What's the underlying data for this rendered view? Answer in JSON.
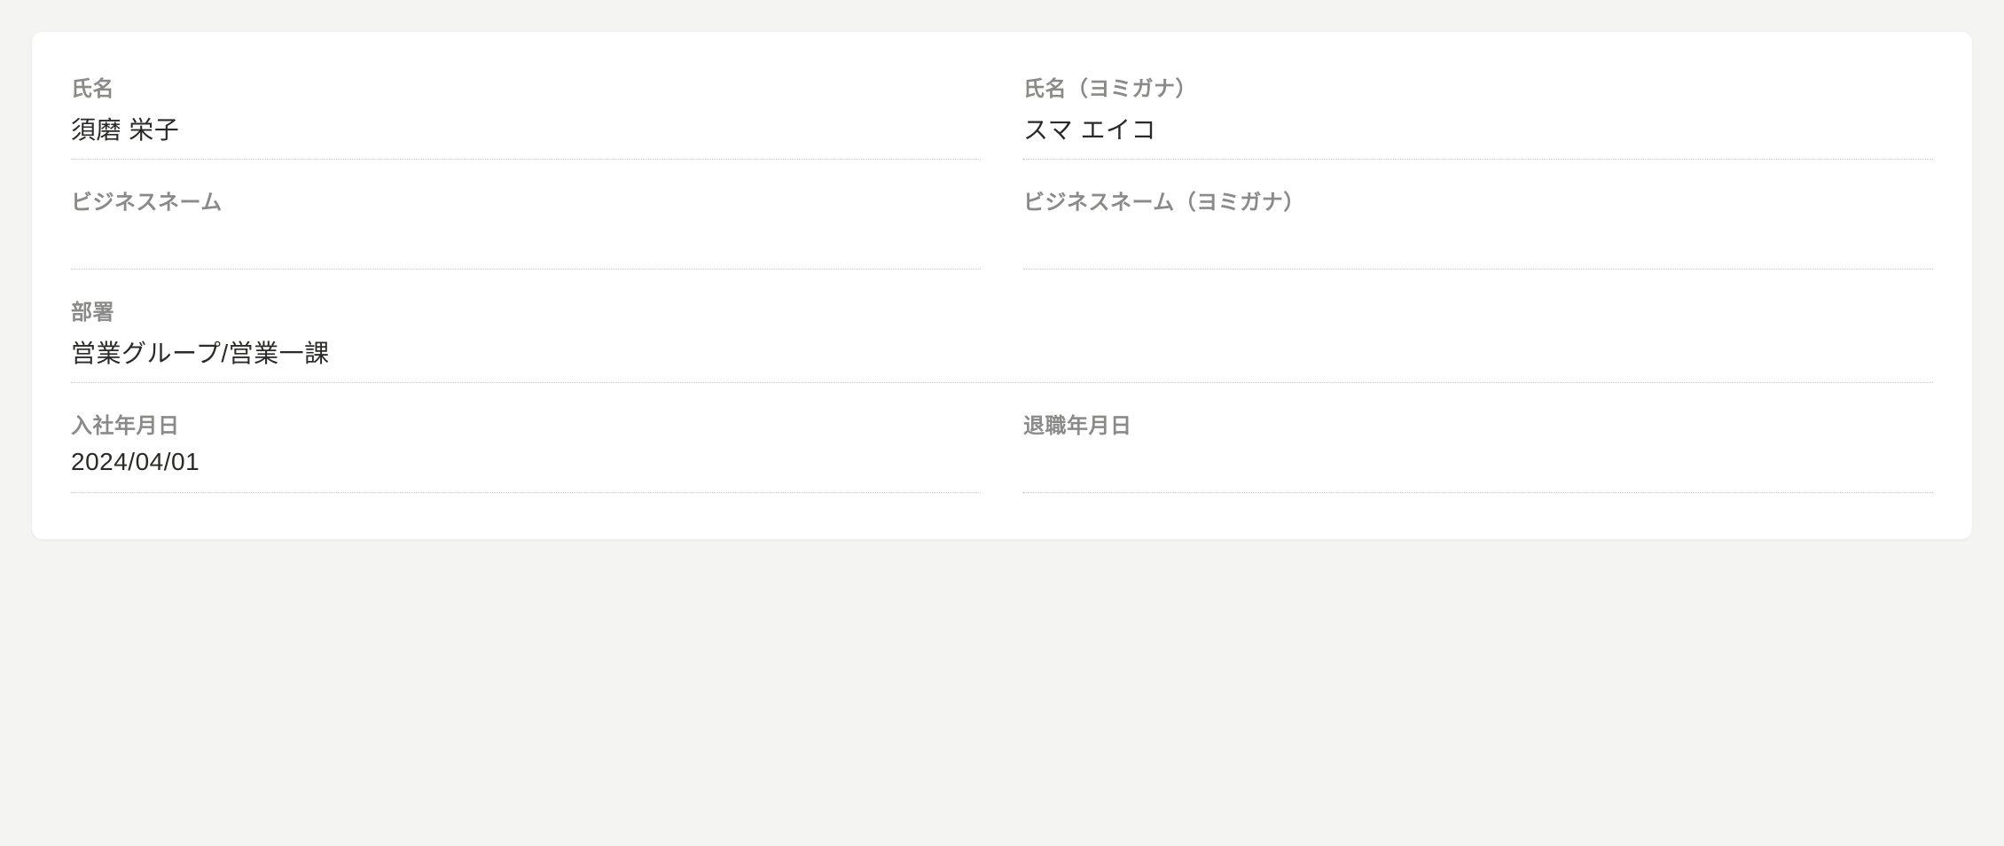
{
  "fields": {
    "name": {
      "label": "氏名",
      "value": "須磨 栄子"
    },
    "name_yomi": {
      "label": "氏名（ヨミガナ）",
      "value": "スマ エイコ"
    },
    "business_name": {
      "label": "ビジネスネーム",
      "value": ""
    },
    "business_name_yomi": {
      "label": "ビジネスネーム（ヨミガナ）",
      "value": ""
    },
    "department": {
      "label": "部署",
      "value": "営業グループ/営業一課"
    },
    "hire_date": {
      "label": "入社年月日",
      "value": "2024/04/01"
    },
    "leave_date": {
      "label": "退職年月日",
      "value": ""
    }
  }
}
